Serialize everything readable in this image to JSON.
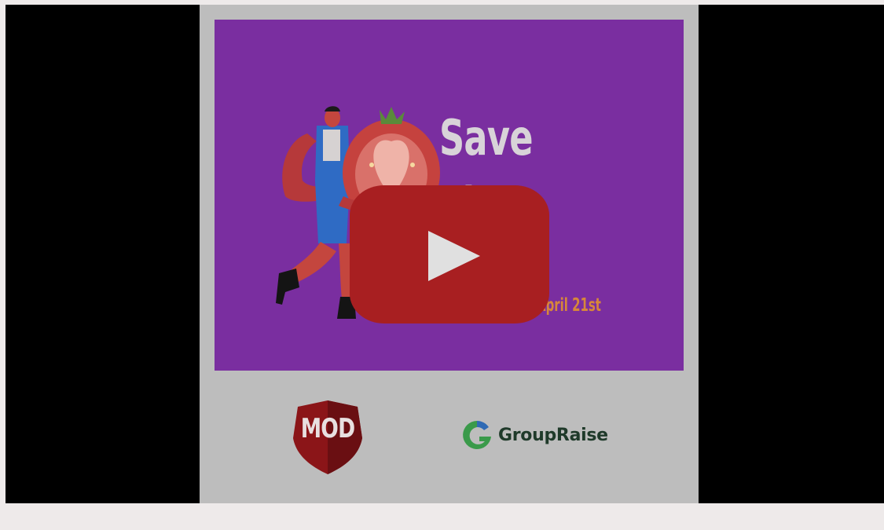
{
  "video": {
    "title_lines": [
      "Save",
      "The"
    ],
    "date_text": "April 21st",
    "logos": {
      "mod": "MOD",
      "groupraise": "GroupRaise"
    }
  },
  "player": {
    "play_icon": "youtube-play-icon",
    "button_color": "#a81f21"
  },
  "colors": {
    "artwork_bg": "#7a2ea0",
    "poster_bg": "#bdbdbd",
    "frame_bg": "#000000"
  }
}
